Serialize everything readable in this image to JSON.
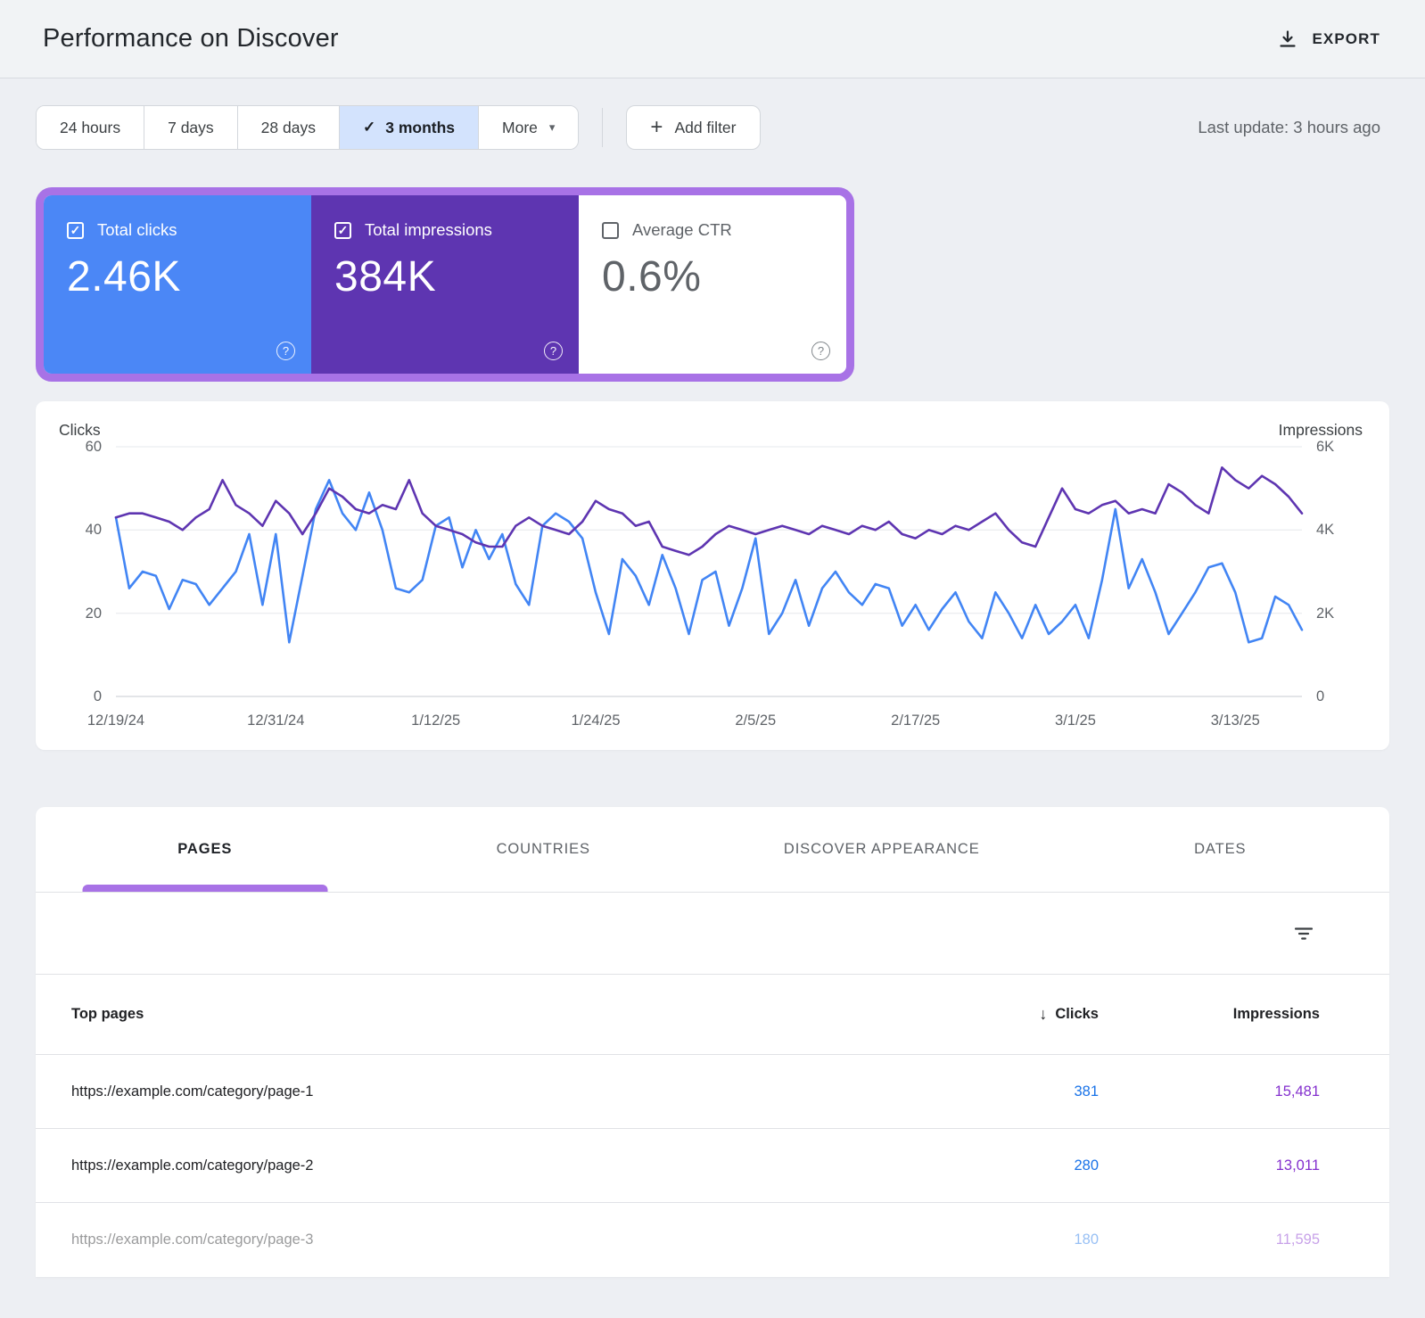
{
  "header": {
    "title": "Performance on Discover",
    "export_label": "EXPORT"
  },
  "filters": {
    "ranges": [
      "24 hours",
      "7 days",
      "28 days",
      "3 months"
    ],
    "selected_range": "3 months",
    "more_label": "More",
    "add_filter_label": "Add filter",
    "last_update": "Last update: 3 hours ago"
  },
  "icons": {
    "check": "✓",
    "plus": "+",
    "caret_down": "▾",
    "sort_down": "↓",
    "help": "?"
  },
  "metric_cards": [
    {
      "label": "Total clicks",
      "value": "2.46K",
      "checked": true,
      "color": "#4b87f6"
    },
    {
      "label": "Total impressions",
      "value": "384K",
      "checked": true,
      "color": "#5e35b1"
    },
    {
      "label": "Average CTR",
      "value": "0.6%",
      "checked": false,
      "color": "#ffffff"
    }
  ],
  "chart_data": {
    "type": "line",
    "title": "Clicks and Impressions over time",
    "left_axis": {
      "title": "Clicks",
      "ticks": [
        "60",
        "40",
        "20",
        "0"
      ],
      "max": 60
    },
    "right_axis": {
      "title": "Impressions",
      "ticks": [
        "6K",
        "4K",
        "2K",
        "0"
      ],
      "max": 6000
    },
    "grid": true,
    "legend": "none",
    "x_tick_labels": [
      "12/19/24",
      "12/31/24",
      "1/12/25",
      "1/24/25",
      "2/5/25",
      "2/17/25",
      "3/1/25",
      "3/13/25"
    ],
    "x_tick_indices": [
      0,
      12,
      24,
      36,
      48,
      60,
      72,
      84
    ],
    "series": [
      {
        "name": "Clicks",
        "axis": "left",
        "color": "#4285f4",
        "values": [
          43,
          26,
          30,
          29,
          21,
          28,
          27,
          22,
          26,
          30,
          39,
          22,
          39,
          13,
          29,
          45,
          52,
          44,
          40,
          49,
          40,
          26,
          25,
          28,
          41,
          43,
          31,
          40,
          33,
          39,
          27,
          22,
          41,
          44,
          42,
          38,
          25,
          15,
          33,
          29,
          22,
          34,
          26,
          15,
          28,
          30,
          17,
          26,
          38,
          15,
          20,
          28,
          17,
          26,
          30,
          25,
          22,
          27,
          26,
          17,
          22,
          16,
          21,
          25,
          18,
          14,
          25,
          20,
          14,
          22,
          15,
          18,
          22,
          14,
          28,
          45,
          26,
          33,
          25,
          15,
          20,
          25,
          31,
          32,
          25,
          13,
          14,
          24,
          22,
          16
        ]
      },
      {
        "name": "Impressions",
        "axis": "right",
        "color": "#5e35b1",
        "values": [
          4300,
          4400,
          4400,
          4300,
          4200,
          4000,
          4300,
          4500,
          5200,
          4600,
          4400,
          4100,
          4700,
          4400,
          3900,
          4400,
          5000,
          4800,
          4500,
          4400,
          4600,
          4500,
          5200,
          4400,
          4100,
          4000,
          3900,
          3700,
          3600,
          3600,
          4100,
          4300,
          4100,
          4000,
          3900,
          4200,
          4700,
          4500,
          4400,
          4100,
          4200,
          3600,
          3500,
          3400,
          3600,
          3900,
          4100,
          4000,
          3900,
          4000,
          4100,
          4000,
          3900,
          4100,
          4000,
          3900,
          4100,
          4000,
          4200,
          3900,
          3800,
          4000,
          3900,
          4100,
          4000,
          4200,
          4400,
          4000,
          3700,
          3600,
          4300,
          5000,
          4500,
          4400,
          4600,
          4700,
          4400,
          4500,
          4400,
          5100,
          4900,
          4600,
          4400,
          5500,
          5200,
          5000,
          5300,
          5100,
          4800,
          4400
        ]
      }
    ]
  },
  "tabs": [
    {
      "label": "PAGES",
      "active": true
    },
    {
      "label": "COUNTRIES",
      "active": false
    },
    {
      "label": "DISCOVER APPEARANCE",
      "active": false
    },
    {
      "label": "DATES",
      "active": false
    }
  ],
  "table": {
    "columns": [
      "Top pages",
      "Clicks",
      "Impressions"
    ],
    "sorted_by": "Clicks",
    "rows": [
      {
        "url": "https://example.com/category/page-1",
        "clicks": "381",
        "impressions": "15,481"
      },
      {
        "url": "https://example.com/category/page-2",
        "clicks": "280",
        "impressions": "13,011"
      },
      {
        "url": "https://example.com/category/page-3",
        "clicks": "180",
        "impressions": "11,595"
      }
    ]
  },
  "colors": {
    "clicks_blue": "#4285f4",
    "impressions_purple": "#5e35b1",
    "highlight_purple": "#a872e6",
    "link_blue": "#1a73e8",
    "link_purple": "#8430ce",
    "selected_range_bg": "#d3e3fd"
  }
}
